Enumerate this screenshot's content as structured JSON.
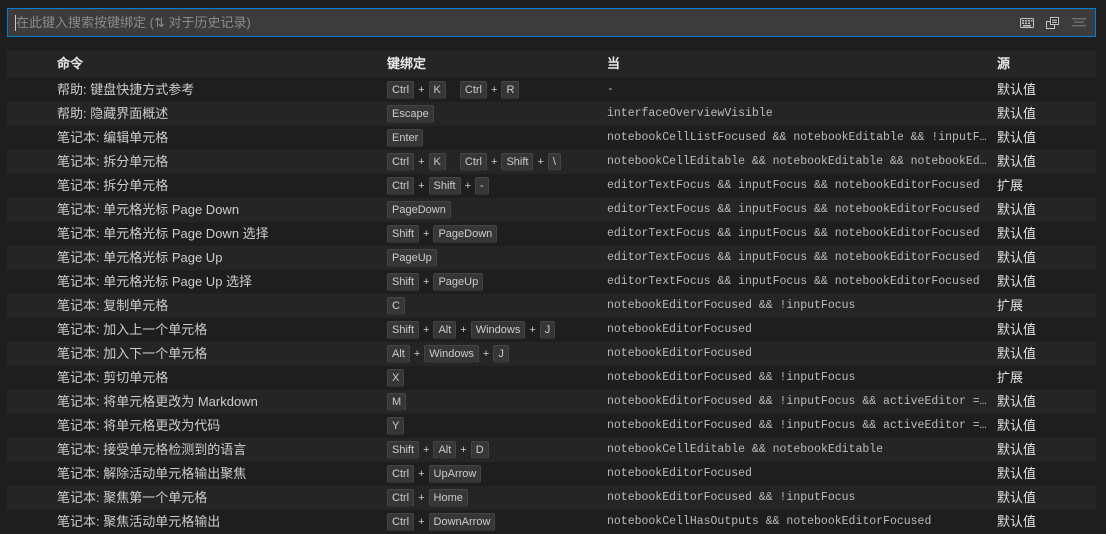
{
  "search": {
    "placeholder": "在此键入搜索按键绑定 (⇅ 对于历史记录)"
  },
  "columns": {
    "command": "命令",
    "keybinding": "键绑定",
    "when": "当",
    "source": "源"
  },
  "icons": [
    "keyboard-icon",
    "sort-by-precedence-icon",
    "clear-filter-icon"
  ],
  "rows": [
    {
      "command": "帮助: 键盘快捷方式参考",
      "chords": [
        [
          "Ctrl",
          "K"
        ],
        [
          "Ctrl",
          "R"
        ]
      ],
      "when": "-",
      "source": "默认值"
    },
    {
      "command": "帮助: 隐藏界面概述",
      "chords": [
        [
          "Escape"
        ]
      ],
      "when": "interfaceOverviewVisible",
      "source": "默认值"
    },
    {
      "command": "笔记本: 编辑单元格",
      "chords": [
        [
          "Enter"
        ]
      ],
      "when": "notebookCellListFocused && notebookEditable && !inputFocus",
      "source": "默认值"
    },
    {
      "command": "笔记本: 拆分单元格",
      "chords": [
        [
          "Ctrl",
          "K"
        ],
        [
          "Ctrl",
          "Shift",
          "\\"
        ]
      ],
      "when": "notebookCellEditable && notebookEditable && notebookEditorFocused",
      "source": "默认值"
    },
    {
      "command": "笔记本: 拆分单元格",
      "chords": [
        [
          "Ctrl",
          "Shift",
          "-"
        ]
      ],
      "when": "editorTextFocus && inputFocus && notebookEditorFocused",
      "source": "扩展"
    },
    {
      "command": "笔记本: 单元格光标 Page Down",
      "chords": [
        [
          "PageDown"
        ]
      ],
      "when": "editorTextFocus && inputFocus && notebookEditorFocused",
      "source": "默认值"
    },
    {
      "command": "笔记本: 单元格光标 Page Down 选择",
      "chords": [
        [
          "Shift",
          "PageDown"
        ]
      ],
      "when": "editorTextFocus && inputFocus && notebookEditorFocused",
      "source": "默认值"
    },
    {
      "command": "笔记本: 单元格光标 Page Up",
      "chords": [
        [
          "PageUp"
        ]
      ],
      "when": "editorTextFocus && inputFocus && notebookEditorFocused",
      "source": "默认值"
    },
    {
      "command": "笔记本: 单元格光标 Page Up 选择",
      "chords": [
        [
          "Shift",
          "PageUp"
        ]
      ],
      "when": "editorTextFocus && inputFocus && notebookEditorFocused",
      "source": "默认值"
    },
    {
      "command": "笔记本: 复制单元格",
      "chords": [
        [
          "C"
        ]
      ],
      "when": "notebookEditorFocused && !inputFocus",
      "source": "扩展"
    },
    {
      "command": "笔记本: 加入上一个单元格",
      "chords": [
        [
          "Shift",
          "Alt",
          "Windows",
          "J"
        ]
      ],
      "when": "notebookEditorFocused",
      "source": "默认值"
    },
    {
      "command": "笔记本: 加入下一个单元格",
      "chords": [
        [
          "Alt",
          "Windows",
          "J"
        ]
      ],
      "when": "notebookEditorFocused",
      "source": "默认值"
    },
    {
      "command": "笔记本: 剪切单元格",
      "chords": [
        [
          "X"
        ]
      ],
      "when": "notebookEditorFocused && !inputFocus",
      "source": "扩展"
    },
    {
      "command": "笔记本: 将单元格更改为 Markdown",
      "chords": [
        [
          "M"
        ]
      ],
      "when": "notebookEditorFocused && !inputFocus && activeEditor == 'workbench.editor.notebook'",
      "source": "默认值"
    },
    {
      "command": "笔记本: 将单元格更改为代码",
      "chords": [
        [
          "Y"
        ]
      ],
      "when": "notebookEditorFocused && !inputFocus && activeEditor == 'workbench.editor.notebook'",
      "source": "默认值"
    },
    {
      "command": "笔记本: 接受单元格检测到的语言",
      "chords": [
        [
          "Shift",
          "Alt",
          "D"
        ]
      ],
      "when": "notebookCellEditable && notebookEditable",
      "source": "默认值"
    },
    {
      "command": "笔记本: 解除活动单元格输出聚焦",
      "chords": [
        [
          "Ctrl",
          "UpArrow"
        ]
      ],
      "when": "notebookEditorFocused",
      "source": "默认值"
    },
    {
      "command": "笔记本: 聚焦第一个单元格",
      "chords": [
        [
          "Ctrl",
          "Home"
        ]
      ],
      "when": "notebookEditorFocused && !inputFocus",
      "source": "默认值"
    },
    {
      "command": "笔记本: 聚焦活动单元格输出",
      "chords": [
        [
          "Ctrl",
          "DownArrow"
        ]
      ],
      "when": "notebookCellHasOutputs && notebookEditorFocused",
      "source": "默认值"
    }
  ]
}
